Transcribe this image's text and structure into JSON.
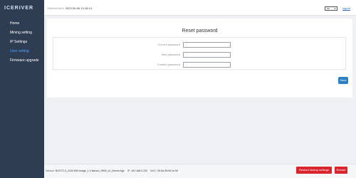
{
  "brand": {
    "logo_text": "ICERIVER"
  },
  "sidebar": {
    "items": [
      {
        "label": "Home"
      },
      {
        "label": "Mining setting"
      },
      {
        "label": "IP Settings"
      },
      {
        "label": "User setting",
        "active": true
      },
      {
        "label": "Firmware upgrade"
      }
    ]
  },
  "topbar": {
    "refresh_label": "Refresh time",
    "refresh_value": "2023-06-06 10:18:14",
    "language": "en",
    "logout_label": "logout"
  },
  "main": {
    "title": "Reset password",
    "fields": [
      {
        "label": "Current password",
        "value": ""
      },
      {
        "label": "New password",
        "value": ""
      },
      {
        "label": "Confirm password",
        "value": ""
      }
    ],
    "save_label": "Save"
  },
  "footer": {
    "version_label": "Version:",
    "version_value": "BOOT1.0_2410 BM-Image_1.0 kamon_0805_s2_0mixer.bgz",
    "ip_label": "IP:",
    "ip_value": "192.168.0.232",
    "mac_label": "MAC:",
    "mac_value": "00:0a:35:00:1e:53",
    "restore_label": "Restore factory settings",
    "restart_label": "Restart"
  },
  "colors": {
    "sidebar_bg": "#2f3d52",
    "active_nav": "#4da3ff",
    "primary": "#2d7fc4",
    "danger": "#d9232d"
  }
}
